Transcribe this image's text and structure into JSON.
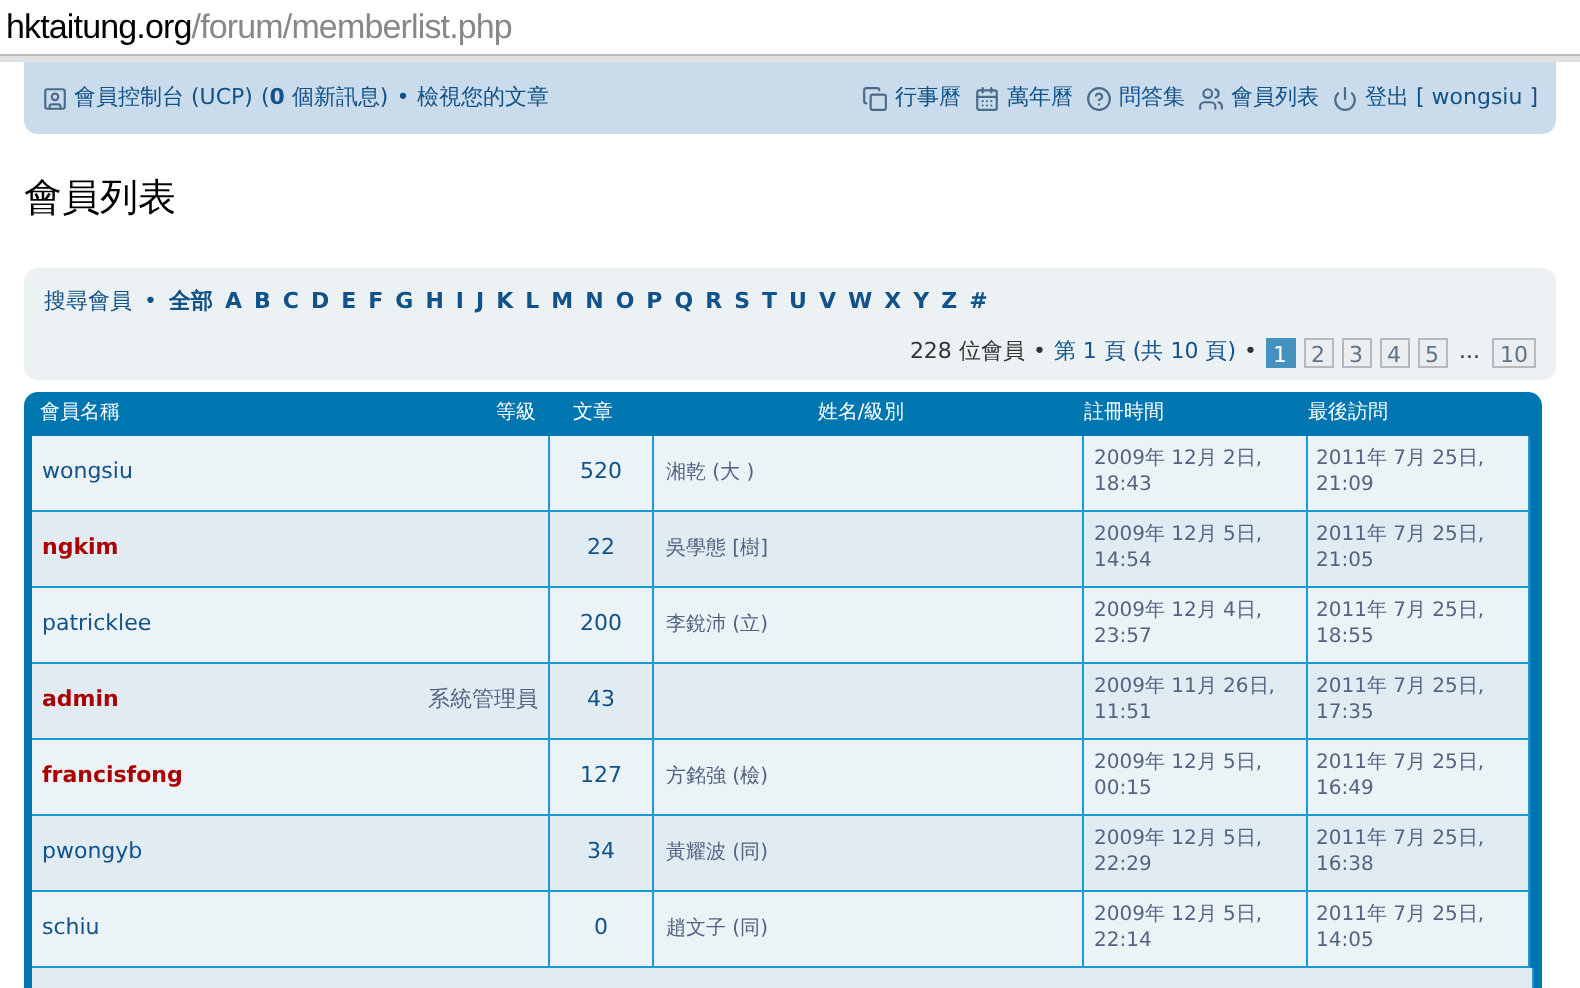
{
  "address_bar": {
    "host": "hktaitung.org",
    "path": "/forum/memberlist.php"
  },
  "nav": {
    "left": [
      {
        "kind": "ucp",
        "text": "會員控制台 (UCP)"
      },
      {
        "kind": "plain",
        "text": "(**0** 個新訊息)"
      },
      {
        "kind": "sep",
        "text": "•"
      },
      {
        "kind": "link",
        "text": "檢視您的文章"
      }
    ],
    "right": [
      {
        "kind": "pages",
        "text": "行事曆"
      },
      {
        "kind": "calendar",
        "text": "萬年曆"
      },
      {
        "kind": "faq",
        "text": "問答集"
      },
      {
        "kind": "members",
        "text": "會員列表"
      },
      {
        "kind": "power",
        "text": "登出 [ wongsiu ]"
      }
    ]
  },
  "page_title": "會員列表",
  "filter": {
    "label": "搜尋會員",
    "sep": "•",
    "letters": [
      "全部",
      "A",
      "B",
      "C",
      "D",
      "E",
      "F",
      "G",
      "H",
      "I",
      "J",
      "K",
      "L",
      "M",
      "N",
      "O",
      "P",
      "Q",
      "R",
      "S",
      "T",
      "U",
      "V",
      "W",
      "X",
      "Y",
      "Z",
      "#"
    ]
  },
  "pagination": {
    "count": "228 位會員",
    "sep": "•",
    "page_info": "第 1 頁 (共 10 頁)",
    "sep2": "•",
    "pages": [
      {
        "label": "1",
        "selected": true
      },
      {
        "label": "2",
        "selected": false
      },
      {
        "label": "3",
        "selected": false
      },
      {
        "label": "4",
        "selected": false
      },
      {
        "label": "5",
        "selected": false
      },
      {
        "label": "...",
        "kind": "gap"
      },
      {
        "label": "10",
        "selected": false
      }
    ]
  },
  "table": {
    "columns": [
      "會員名稱",
      "等級",
      "文章",
      "姓名/級別",
      "註冊時間",
      "最後訪問"
    ],
    "rows": [
      {
        "name": "wongsiu",
        "color": "#105289",
        "rank": "",
        "posts": "520",
        "realname": "湘乾 (大 )",
        "joined": "2009年 12月 2日, 18:43",
        "last": "2011年 7月 25日, 21:09"
      },
      {
        "name": "ngkim",
        "color": "#aa0000",
        "rank": "",
        "posts": "22",
        "realname": "吳學態 [樹]",
        "joined": "2009年 12月 5日, 14:54",
        "last": "2011年 7月 25日, 21:05"
      },
      {
        "name": "patricklee",
        "color": "#105289",
        "rank": "",
        "posts": "200",
        "realname": "李銳沛 (立)",
        "joined": "2009年 12月 4日, 23:57",
        "last": "2011年 7月 25日, 18:55"
      },
      {
        "name": "admin",
        "color": "#aa0000",
        "rank": "系統管理員",
        "posts": "43",
        "realname": "",
        "joined": "2009年 11月 26日, 11:51",
        "last": "2011年 7月 25日, 17:35"
      },
      {
        "name": "francisfong",
        "color": "#aa0000",
        "rank": "",
        "posts": "127",
        "realname": "方銘強 (檢)",
        "joined": "2009年 12月 5日, 00:15",
        "last": "2011年 7月 25日, 16:49"
      },
      {
        "name": "pwongyb",
        "color": "#105289",
        "rank": "",
        "posts": "34",
        "realname": "黃耀波 (同)",
        "joined": "2009年 12月 5日, 22:29",
        "last": "2011年 7月 25日, 16:38"
      },
      {
        "name": "schiu",
        "color": "#105289",
        "rank": "",
        "posts": "0",
        "realname": "趙文子 (同)",
        "joined": "2009年 12月 5日, 22:14",
        "last": "2011年 7月 25日, 14:05"
      }
    ]
  }
}
